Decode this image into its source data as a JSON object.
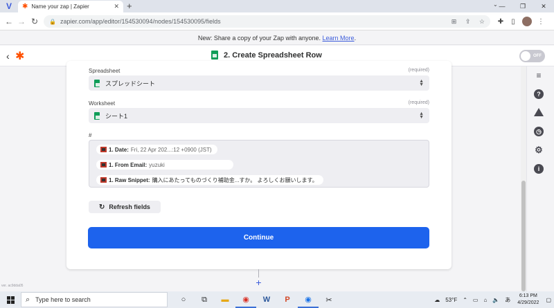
{
  "browser": {
    "tab_title": "Name your zap | Zapier",
    "url": "zapier.com/app/editor/154530094/nodes/154530095/fields"
  },
  "banner": {
    "text": "New: Share a copy of your Zap with anyone.",
    "link": "Learn More"
  },
  "zap_header": {
    "step_title": "2. Create Spreadsheet Row",
    "toggle_label": "OFF"
  },
  "form": {
    "spreadsheet": {
      "label": "Spreadsheet",
      "required": "(required)",
      "value": "スプレッドシート"
    },
    "worksheet": {
      "label": "Worksheet",
      "required": "(required)",
      "value": "シート1"
    },
    "number_field": {
      "label": "#",
      "pills": [
        {
          "key": "1. Date:",
          "value": "Fri, 22 Apr 202...:12 +0900 (JST)"
        },
        {
          "key": "1. From Email:",
          "value": "yuzuki"
        },
        {
          "key": "1. Raw Snippet:",
          "value": "購入にあたってものづくり補助金...すか。 よろしくお願いします。"
        }
      ]
    },
    "refresh_label": "Refresh fields",
    "continue_label": "Continue"
  },
  "version": "ver. ac9dda05",
  "taskbar": {
    "search_placeholder": "Type here to search",
    "weather": "53°F",
    "ime": "あ",
    "time": "6:13 PM",
    "date": "4/29/2022"
  },
  "colors": {
    "zapier_orange": "#ff4f00",
    "continue_blue": "#1d63ed",
    "sheets_green": "#0f9d58"
  }
}
